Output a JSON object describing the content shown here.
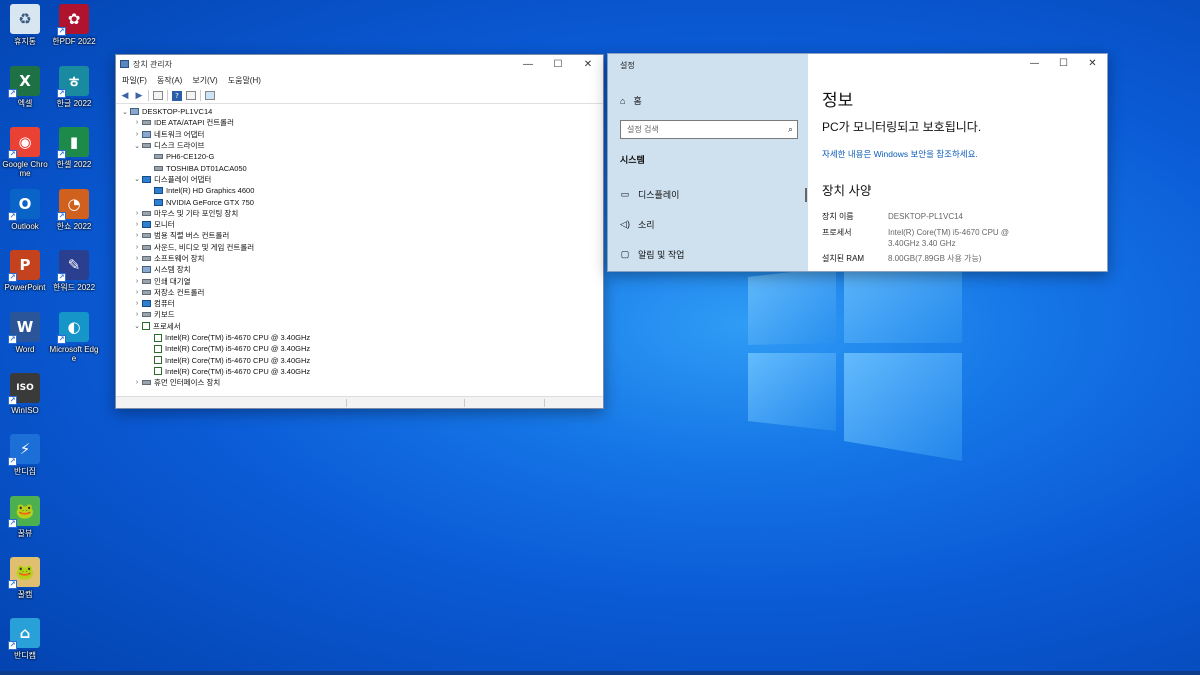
{
  "desktop": {
    "icons": [
      {
        "label": "휴지통",
        "glyph": "♻",
        "color": "#d8e6f2",
        "text_color": "#3a5a80"
      },
      {
        "label": "엑셀",
        "glyph": "X",
        "color": "#1e7145"
      },
      {
        "label": "Google Chrome",
        "glyph": "◉",
        "color": "#e94235"
      },
      {
        "label": "Outlook",
        "glyph": "O",
        "color": "#0a64c8"
      },
      {
        "label": "PowerPoint",
        "glyph": "P",
        "color": "#c4421e"
      },
      {
        "label": "Word",
        "glyph": "W",
        "color": "#2a5699"
      },
      {
        "label": "WinISO",
        "glyph": "ISO",
        "color": "#3a3a3a"
      },
      {
        "label": "반디집",
        "glyph": "⚡",
        "color": "#1c6fd6"
      },
      {
        "label": "꿀뷰",
        "glyph": "🐸",
        "color": "#4caf50"
      },
      {
        "label": "꿀캠",
        "glyph": "🐸",
        "color": "#e0c070"
      },
      {
        "label": "반디캠",
        "glyph": "⌂",
        "color": "#2aa0d8"
      },
      {
        "label": "한PDF 2022",
        "glyph": "✿",
        "color": "#b0132e"
      },
      {
        "label": "한글 2022",
        "glyph": "ㅎ",
        "color": "#1a8aa0"
      },
      {
        "label": "한셀 2022",
        "glyph": "▮",
        "color": "#1e8a4a"
      },
      {
        "label": "한쇼 2022",
        "glyph": "◔",
        "color": "#d0601e"
      },
      {
        "label": "한워드 2022",
        "glyph": "✎",
        "color": "#2a3f8f"
      },
      {
        "label": "Microsoft Edge",
        "glyph": "◐",
        "color": "#1595c8"
      }
    ]
  },
  "device_manager": {
    "title": "장치 관리자",
    "menus": [
      "파일(F)",
      "동작(A)",
      "보기(V)",
      "도움말(H)"
    ],
    "tree": [
      {
        "label": "DESKTOP-PL1VC14",
        "level": 0,
        "exp": "⌄",
        "icon": "pc"
      },
      {
        "label": "IDE ATA/ATAPI 컨트롤러",
        "level": 1,
        "exp": "›",
        "icon": "disk"
      },
      {
        "label": "네트워크 어댑터",
        "level": 1,
        "exp": "›",
        "icon": "pc"
      },
      {
        "label": "디스크 드라이브",
        "level": 1,
        "exp": "⌄",
        "icon": "disk"
      },
      {
        "label": "PH6-CE120-G",
        "level": 2,
        "exp": "",
        "icon": "disk"
      },
      {
        "label": "TOSHIBA DT01ACA050",
        "level": 2,
        "exp": "",
        "icon": "disk"
      },
      {
        "label": "디스플레이 어댑터",
        "level": 1,
        "exp": "⌄",
        "icon": "mon"
      },
      {
        "label": "Intel(R) HD Graphics 4600",
        "level": 2,
        "exp": "",
        "icon": "mon"
      },
      {
        "label": "NVIDIA GeForce GTX 750",
        "level": 2,
        "exp": "",
        "icon": "mon"
      },
      {
        "label": "마우스 및 기타 포인팅 장치",
        "level": 1,
        "exp": "›",
        "icon": "disk"
      },
      {
        "label": "모니터",
        "level": 1,
        "exp": "›",
        "icon": "mon"
      },
      {
        "label": "범용 직렬 버스 컨트롤러",
        "level": 1,
        "exp": "›",
        "icon": "disk"
      },
      {
        "label": "사운드, 비디오 및 게임 컨트롤러",
        "level": 1,
        "exp": "›",
        "icon": "disk"
      },
      {
        "label": "소프트웨어 장치",
        "level": 1,
        "exp": "›",
        "icon": "disk"
      },
      {
        "label": "시스템 장치",
        "level": 1,
        "exp": "›",
        "icon": "pc"
      },
      {
        "label": "인쇄 대기열",
        "level": 1,
        "exp": "›",
        "icon": "disk"
      },
      {
        "label": "저장소 컨트롤러",
        "level": 1,
        "exp": "›",
        "icon": "disk"
      },
      {
        "label": "컴퓨터",
        "level": 1,
        "exp": "›",
        "icon": "mon"
      },
      {
        "label": "키보드",
        "level": 1,
        "exp": "›",
        "icon": "disk"
      },
      {
        "label": "프로세서",
        "level": 1,
        "exp": "⌄",
        "icon": "cpu"
      },
      {
        "label": "Intel(R) Core(TM) i5-4670 CPU @ 3.40GHz",
        "level": 2,
        "exp": "",
        "icon": "cpu"
      },
      {
        "label": "Intel(R) Core(TM) i5-4670 CPU @ 3.40GHz",
        "level": 2,
        "exp": "",
        "icon": "cpu"
      },
      {
        "label": "Intel(R) Core(TM) i5-4670 CPU @ 3.40GHz",
        "level": 2,
        "exp": "",
        "icon": "cpu"
      },
      {
        "label": "Intel(R) Core(TM) i5-4670 CPU @ 3.40GHz",
        "level": 2,
        "exp": "",
        "icon": "cpu"
      },
      {
        "label": "휴먼 인터페이스 장치",
        "level": 1,
        "exp": "›",
        "icon": "disk"
      }
    ]
  },
  "settings": {
    "title": "설정",
    "home_label": "홈",
    "search_placeholder": "설정 검색",
    "section": "시스템",
    "nav": [
      {
        "label": "디스플레이",
        "icon": "▭"
      },
      {
        "label": "소리",
        "icon": "◁)"
      },
      {
        "label": "알림 및 작업",
        "icon": "▢"
      }
    ],
    "page_title": "정보",
    "protect_text": "PC가 모니터링되고 보호됩니다.",
    "link_text": "자세한 내용은 Windows 보안을 참조하세요.",
    "specs_title": "장치 사양",
    "specs": [
      {
        "key": "장치 이름",
        "value": "DESKTOP-PL1VC14"
      },
      {
        "key": "프로세서",
        "value": "Intel(R) Core(TM) i5-4670 CPU @ 3.40GHz   3.40 GHz"
      },
      {
        "key": "설치된 RAM",
        "value": "8.00GB(7.89GB 사용 가능)"
      }
    ]
  }
}
